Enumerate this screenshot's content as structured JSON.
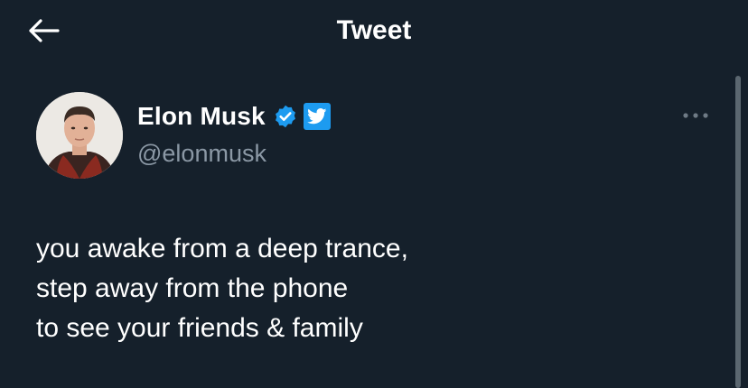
{
  "header": {
    "title": "Tweet",
    "back_icon": "arrow-left-icon"
  },
  "author": {
    "display_name": "Elon Musk",
    "handle": "@elonmusk",
    "verified_icon": "verified-badge-icon",
    "affiliate_icon": "twitter-bird-icon"
  },
  "tweet": {
    "lines": [
      "you awake from a deep trance,",
      "step away from the phone",
      "to see your friends & family"
    ]
  },
  "colors": {
    "background": "#15202b",
    "text": "#ffffff",
    "secondary_text": "#8b98a5",
    "accent": "#1d9bf0"
  }
}
